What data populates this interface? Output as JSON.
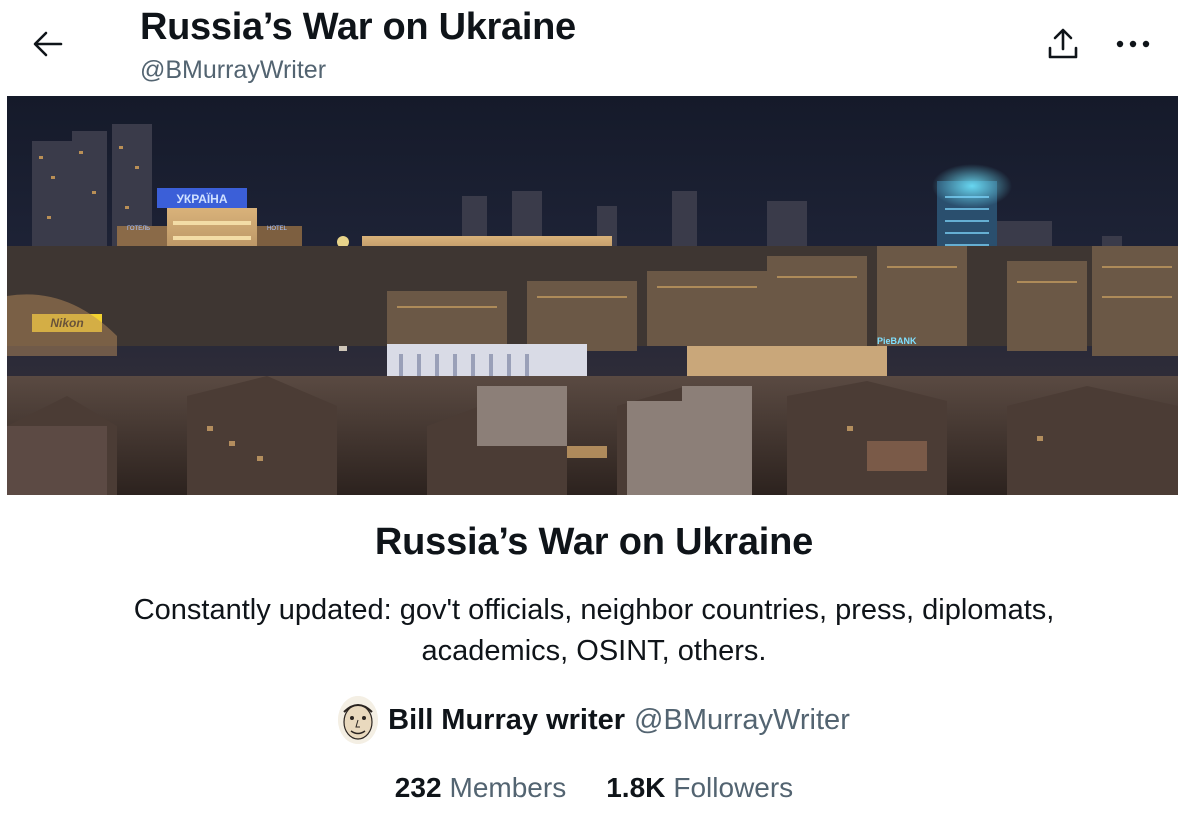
{
  "header": {
    "title": "Russia’s War on Ukraine",
    "handle": "@BMurrayWriter",
    "back_icon": "arrow-left-icon",
    "share_icon": "share-upload-icon",
    "more_icon": "more-horizontal-icon"
  },
  "banner": {
    "signs": {
      "hotel": "УКРАЇНА",
      "nikon": "Nikon",
      "bank": "PieBANK",
      "hotel_small": "ГОТЕЛЬ",
      "hotel_small2": "HOTEL"
    }
  },
  "list": {
    "name": "Russia’s War on Ukraine",
    "description": "Constantly updated: gov't officials, neighbor countries, press, diplomats, academics, OSINT, others."
  },
  "owner": {
    "name": "Bill Murray writer",
    "handle": "@BMurrayWriter"
  },
  "stats": {
    "members_count": "232",
    "members_label": "Members",
    "followers_count": "1.8K",
    "followers_label": "Followers"
  },
  "colors": {
    "text_primary": "#0f1419",
    "text_secondary": "#536471",
    "background": "#ffffff"
  }
}
